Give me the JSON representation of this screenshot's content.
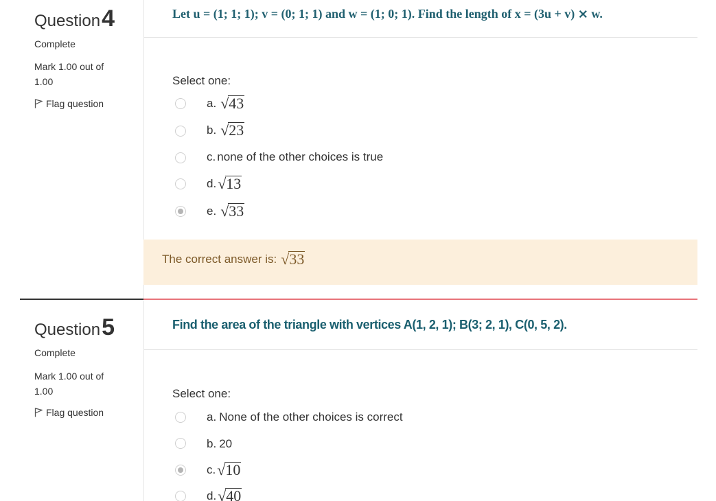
{
  "questions": [
    {
      "label": "Question",
      "number": "4",
      "state": "Complete",
      "grade": "Mark 1.00 out of 1.00",
      "flag": "Flag question",
      "text": "Let u = (1; 1; 1); v = (0; 1; 1) and w = (1; 0; 1). Find the length of x = (3u + v) ⨯ w.",
      "prompt": "Select one:",
      "options": [
        {
          "letter": "a.",
          "text": "",
          "sqrt": "43",
          "selected": false
        },
        {
          "letter": "b.",
          "text": "",
          "sqrt": "23",
          "selected": false
        },
        {
          "letter": "c.",
          "text": "none of the other choices is true",
          "sqrt": "",
          "selected": false
        },
        {
          "letter": "d.",
          "text": "",
          "sqrt": "13",
          "selected": false
        },
        {
          "letter": "e.",
          "text": "",
          "sqrt": "33",
          "selected": true
        }
      ],
      "feedback_label": "The correct answer is:",
      "feedback_sqrt": "33"
    },
    {
      "label": "Question",
      "number": "5",
      "state": "Complete",
      "grade": "Mark 1.00 out of 1.00",
      "flag": "Flag question",
      "text": "Find the area of the triangle with vertices A(1, 2, 1); B(3; 2, 1), C(0, 5, 2).",
      "prompt": "Select one:",
      "options": [
        {
          "letter": "a.",
          "text": "None of the other choices is correct",
          "sqrt": "",
          "selected": false
        },
        {
          "letter": "b.",
          "text": "20",
          "sqrt": "",
          "selected": false
        },
        {
          "letter": "c.",
          "text": "",
          "sqrt": "10",
          "selected": true
        },
        {
          "letter": "d.",
          "text": "",
          "sqrt": "40",
          "selected": false
        }
      ]
    }
  ],
  "colors": {
    "feedback_bg": "#fcefdc",
    "question_text": "#1f5f6f",
    "separator_red": "#e8737a"
  }
}
